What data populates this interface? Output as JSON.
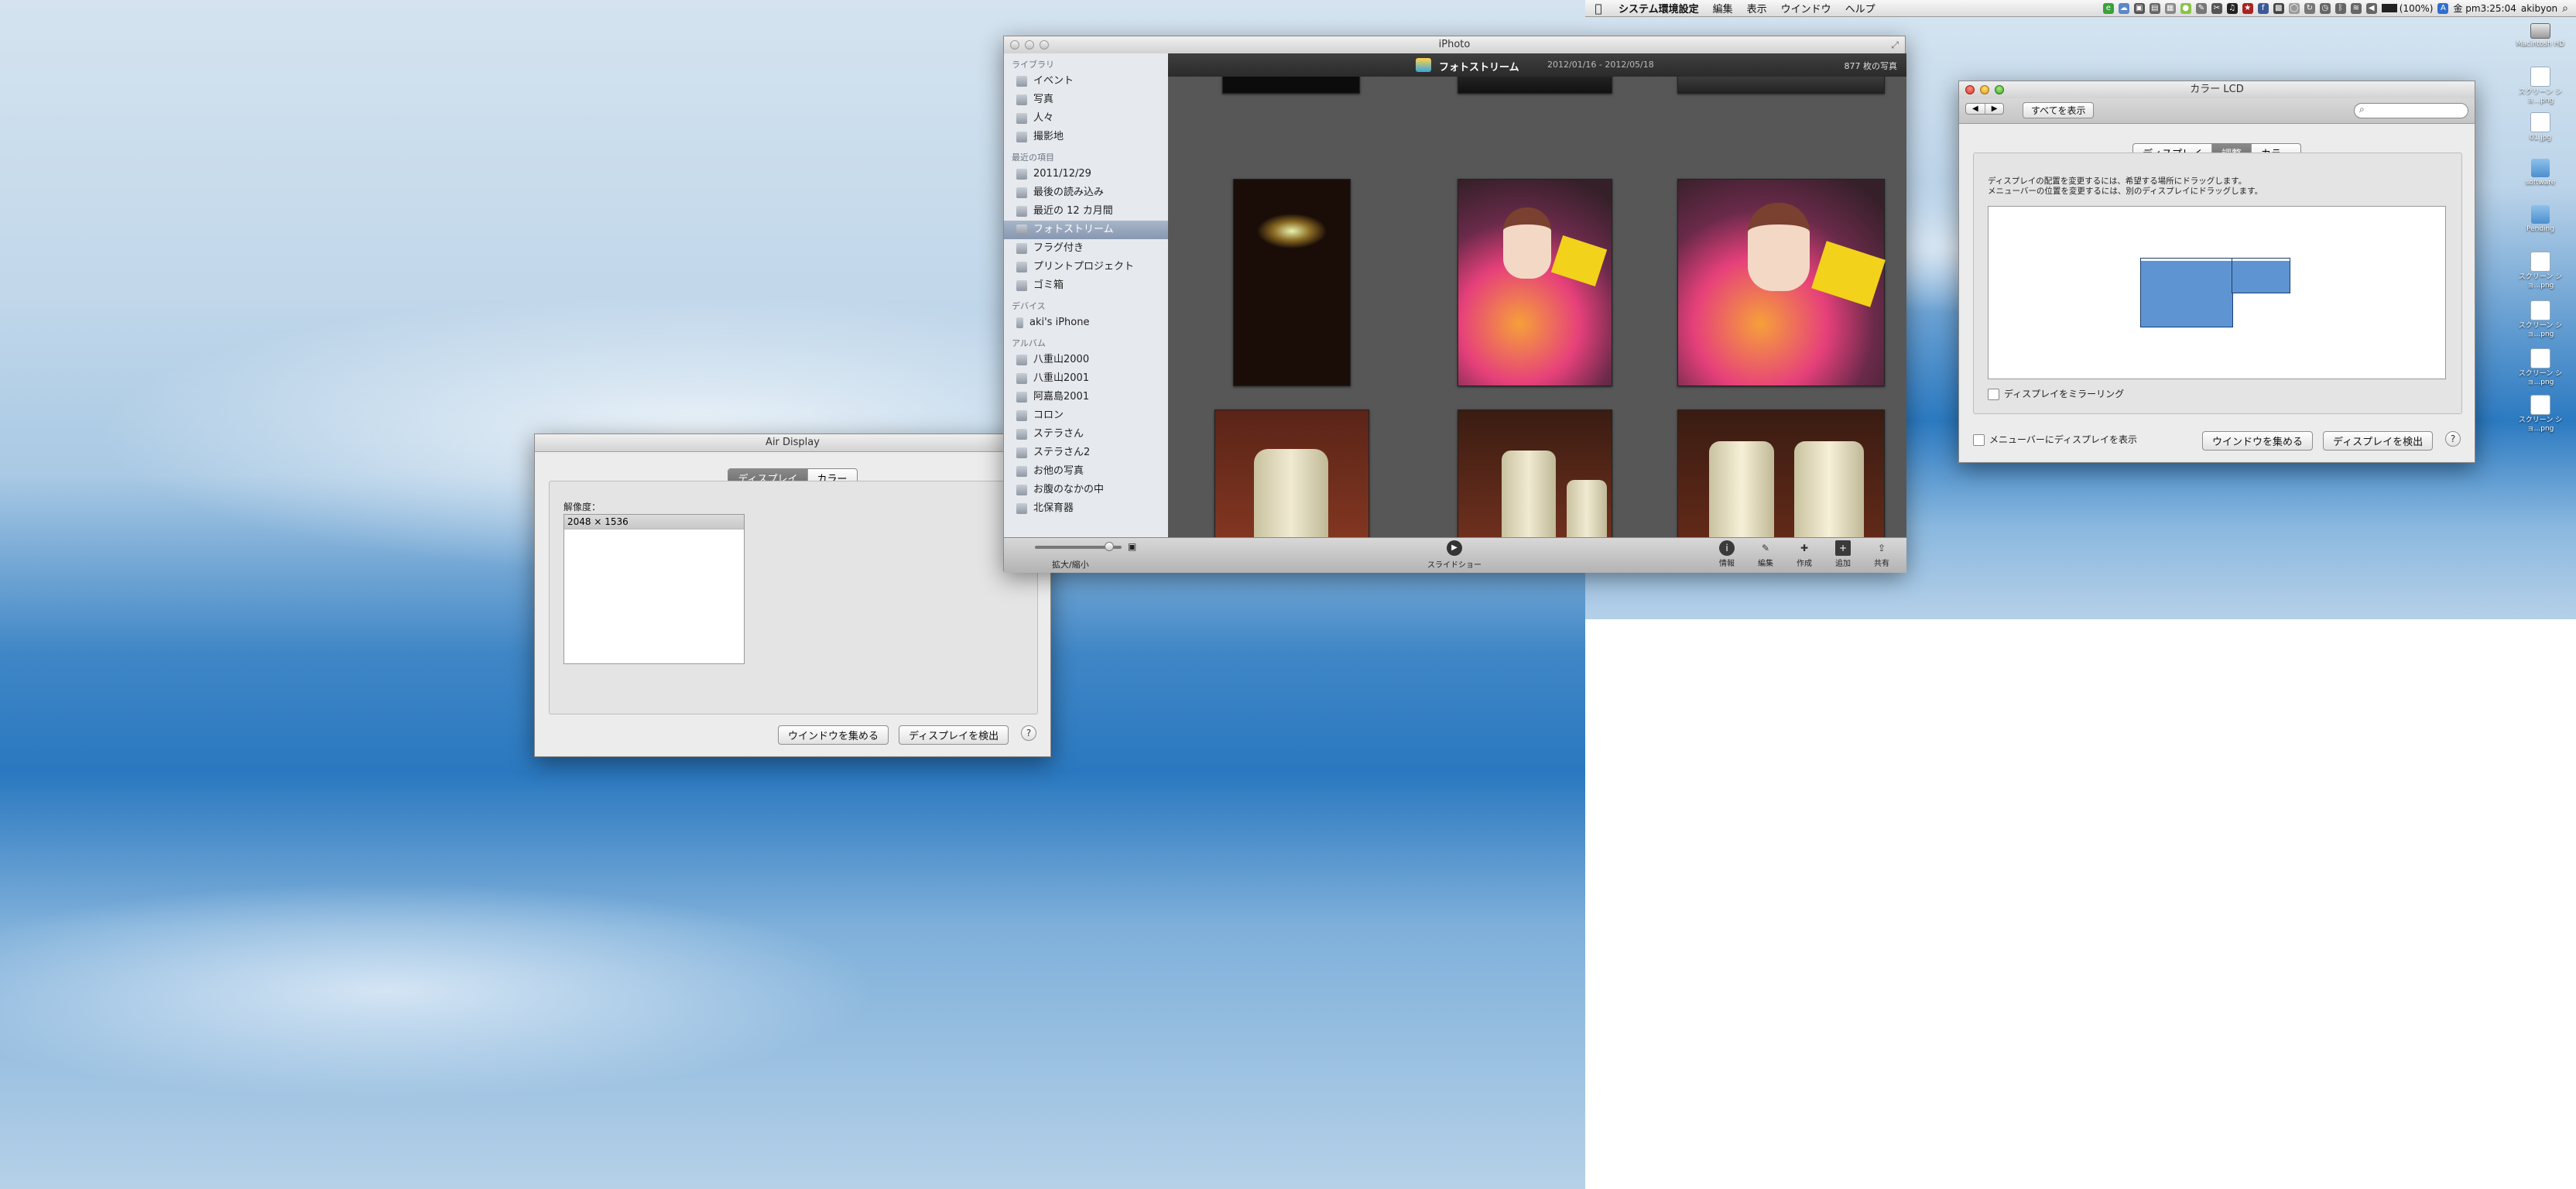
{
  "menubar": {
    "apple": "",
    "items": [
      "システム環境設定",
      "編集",
      "表示",
      "ウインドウ",
      "ヘルプ"
    ],
    "battery": "(100%)",
    "clock": "金 pm3:25:04",
    "user": "akibyon"
  },
  "desktop_icons": [
    {
      "label": "Macintosh HD"
    },
    {
      "label": "スクリーン ショ...png"
    },
    {
      "label": "01.jpg"
    },
    {
      "label": "software"
    },
    {
      "label": "Pending"
    },
    {
      "label": "スクリーン ショ...png"
    },
    {
      "label": "スクリーン ショ...png"
    },
    {
      "label": "スクリーン ショ...png"
    },
    {
      "label": "スクリーン ショ...png"
    }
  ],
  "air_display": {
    "title": "Air Display",
    "tabs": [
      "ディスプレイ",
      "カラー"
    ],
    "resolution_label": "解像度：",
    "resolutions": [
      "2048 × 1536"
    ],
    "gather_button": "ウインドウを集める",
    "detect_button": "ディスプレイを検出",
    "help": "?"
  },
  "iphoto": {
    "title": "iPhoto",
    "sections": [
      {
        "header": "ライブラリ",
        "items": [
          "イベント",
          "写真",
          "人々",
          "撮影地"
        ]
      },
      {
        "header": "最近の項目",
        "items": [
          "2011/12/29",
          "最後の読み込み",
          "最近の 12 カ月間",
          "フォトストリーム",
          "フラグ付き",
          "プリントプロジェクト",
          "ゴミ箱"
        ]
      },
      {
        "header": "デバイス",
        "items": [
          "aki's iPhone"
        ]
      },
      {
        "header": "アルバム",
        "items": [
          "八重山2000",
          "八重山2001",
          "阿嘉島2001",
          "コロン",
          "ステラさん",
          "ステラさん2",
          "お他の写真",
          "お腹のなかの中",
          "北保育器"
        ]
      }
    ],
    "selected_item": "フォトストリーム",
    "stream_title": "フォトストリーム",
    "date_range": "2012/01/16 - 2012/05/18",
    "photo_count": "877 枚の写真",
    "zoom_label": "拡大/縮小",
    "slideshow_label": "スライドショー",
    "tools": [
      "情報",
      "編集",
      "作成",
      "追加",
      "共有"
    ]
  },
  "color_lcd": {
    "title": "カラー LCD",
    "show_all": "すべてを表示",
    "search_placeholder": "",
    "tabs": [
      "ディスプレイ",
      "調整",
      "カラー"
    ],
    "instruction1": "ディスプレイの配置を変更するには、希望する場所にドラッグします。",
    "instruction2": "メニューバーの位置を変更するには、別のディスプレイにドラッグします。",
    "mirror_label": "ディスプレイをミラーリング",
    "menubar_checkbox": "メニューバーにディスプレイを表示",
    "gather_button": "ウインドウを集める",
    "detect_button": "ディスプレイを検出",
    "help": "?"
  },
  "colors": {
    "accent": "#5e94d2",
    "sidebar_selected": "#8797b1",
    "photo_bg": "#575757"
  }
}
